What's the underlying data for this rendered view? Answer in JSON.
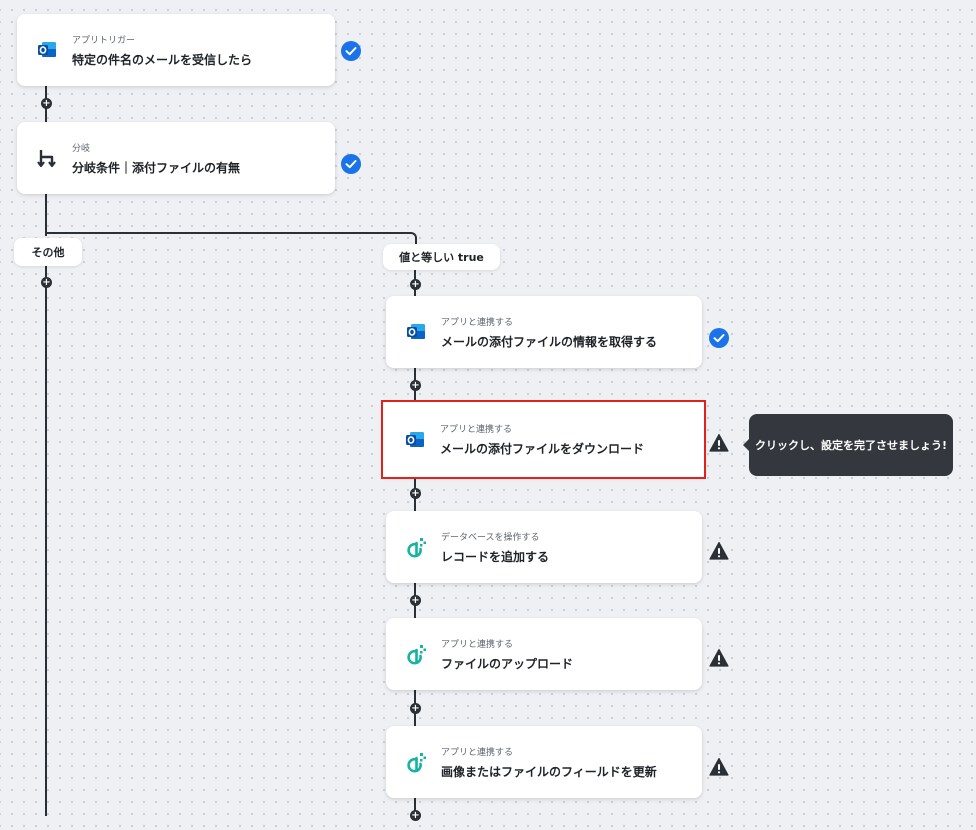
{
  "flow": {
    "trigger": {
      "subtitle": "アプリトリガー",
      "title": "特定の件名のメールを受信したら",
      "icon": "outlook-icon",
      "status": "complete"
    },
    "branch": {
      "subtitle": "分岐",
      "title": "分岐条件｜添付ファイルの有無",
      "icon": "branch-icon",
      "status": "complete"
    },
    "branch_labels": {
      "other": "その他",
      "true": "値と等しい true"
    },
    "steps": [
      {
        "subtitle": "アプリと連携する",
        "title": "メールの添付ファイルの情報を取得する",
        "icon": "outlook-icon",
        "status": "complete"
      },
      {
        "subtitle": "アプリと連携する",
        "title": "メールの添付ファイルをダウンロード",
        "icon": "outlook-icon",
        "status": "warning",
        "selected": true
      },
      {
        "subtitle": "データベースを操作する",
        "title": "レコードを追加する",
        "icon": "database-app-icon",
        "status": "warning"
      },
      {
        "subtitle": "アプリと連携する",
        "title": "ファイルのアップロード",
        "icon": "database-app-icon",
        "status": "warning"
      },
      {
        "subtitle": "アプリと連携する",
        "title": "画像またはファイルのフィールドを更新",
        "icon": "database-app-icon",
        "status": "warning"
      }
    ]
  },
  "tooltip": {
    "text": "クリックし、設定を完了させましょう!"
  },
  "colors": {
    "check": "#1a73e8",
    "warning": "#2b2f36",
    "selected_border": "#e0221b",
    "outlook_blue": "#0a64c8",
    "teal": "#16b3a3"
  }
}
